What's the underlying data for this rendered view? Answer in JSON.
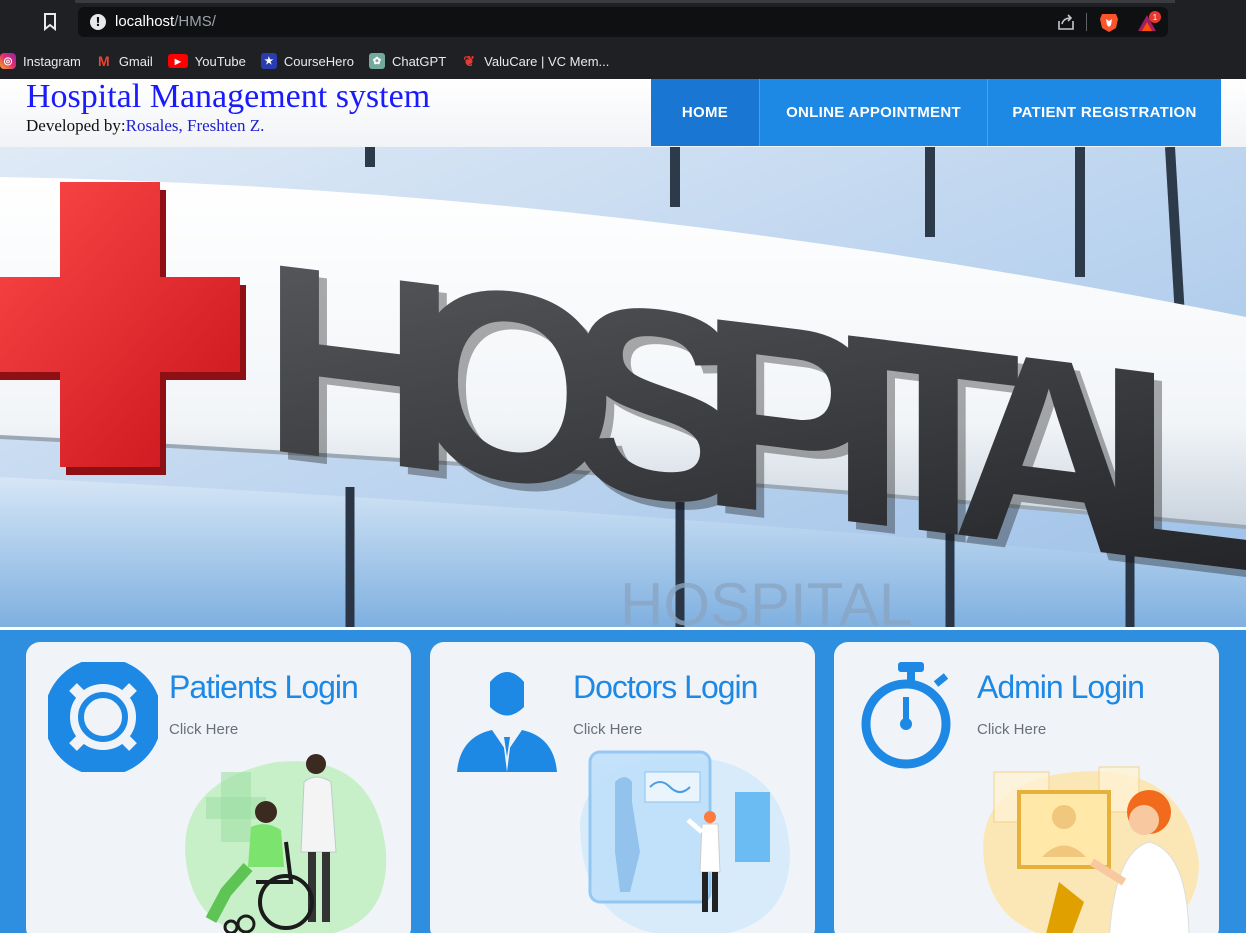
{
  "browser": {
    "url_host": "localhost",
    "url_path": "/HMS/",
    "bookmarks": [
      {
        "label": "Instagram",
        "icon": "instagram-icon",
        "color": "#e1306c"
      },
      {
        "label": "Gmail",
        "icon": "gmail-icon",
        "color": "#ea4335"
      },
      {
        "label": "YouTube",
        "icon": "youtube-icon",
        "color": "#ff0000"
      },
      {
        "label": "CourseHero",
        "icon": "coursehero-icon",
        "color": "#2a5db0"
      },
      {
        "label": "ChatGPT",
        "icon": "chatgpt-icon",
        "color": "#74aa9c"
      },
      {
        "label": "ValuCare | VC Mem...",
        "icon": "valucare-icon",
        "color": "#e53935"
      }
    ],
    "notification_count": "1"
  },
  "header": {
    "title": "Hospital Management system",
    "developed_by_label": "Developed by:",
    "developer_name": "Rosales, Freshten Z."
  },
  "nav": {
    "items": [
      {
        "label": "HOME",
        "active": true
      },
      {
        "label": "ONLINE APPOINTMENT",
        "active": false
      },
      {
        "label": "PATIENT REGISTRATION",
        "active": false
      }
    ]
  },
  "hero": {
    "sign_text": "HOSPITAL",
    "reflection_text": "HOSPITAL"
  },
  "cards": [
    {
      "title": "Patients Login",
      "link": "Click Here",
      "icon": "lifebuoy-icon"
    },
    {
      "title": "Doctors Login",
      "link": "Click Here",
      "icon": "doctor-icon"
    },
    {
      "title": "Admin Login",
      "link": "Click Here",
      "icon": "stopwatch-icon"
    }
  ],
  "colors": {
    "accent": "#1e88e5",
    "title_blue": "#1a1aff",
    "cross_red": "#e8232a"
  }
}
